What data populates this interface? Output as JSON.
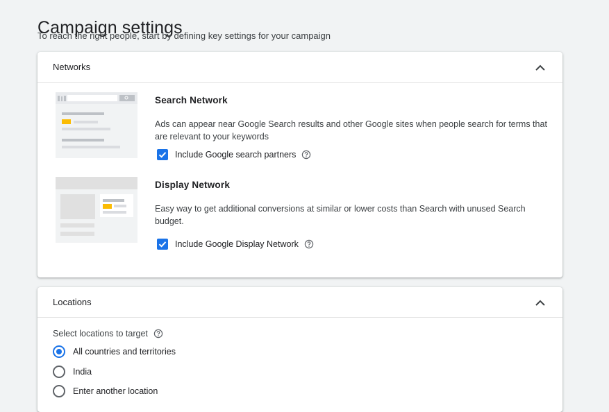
{
  "page": {
    "title": "Campaign settings",
    "subtitle": "To reach the right people, start by defining key settings for your campaign"
  },
  "networks": {
    "header": "Networks",
    "search": {
      "title": "Search Network",
      "description": "Ads can appear near Google Search results and other Google sites when people search for terms that are relevant to your keywords",
      "checkbox_label": "Include Google search partners",
      "checked": true
    },
    "display": {
      "title": "Display Network",
      "description": "Easy way to get additional conversions at similar or lower costs than Search with unused Search budget.",
      "checkbox_label": "Include Google Display Network",
      "checked": true
    }
  },
  "locations": {
    "header": "Locations",
    "prompt": "Select locations to target",
    "options": [
      {
        "label": "All countries and territories",
        "selected": true
      },
      {
        "label": "India",
        "selected": false
      },
      {
        "label": "Enter another location",
        "selected": false
      }
    ]
  },
  "colors": {
    "accent": "#1a73e8",
    "highlight": "#fbbc04",
    "background": "#f1f3f4"
  }
}
